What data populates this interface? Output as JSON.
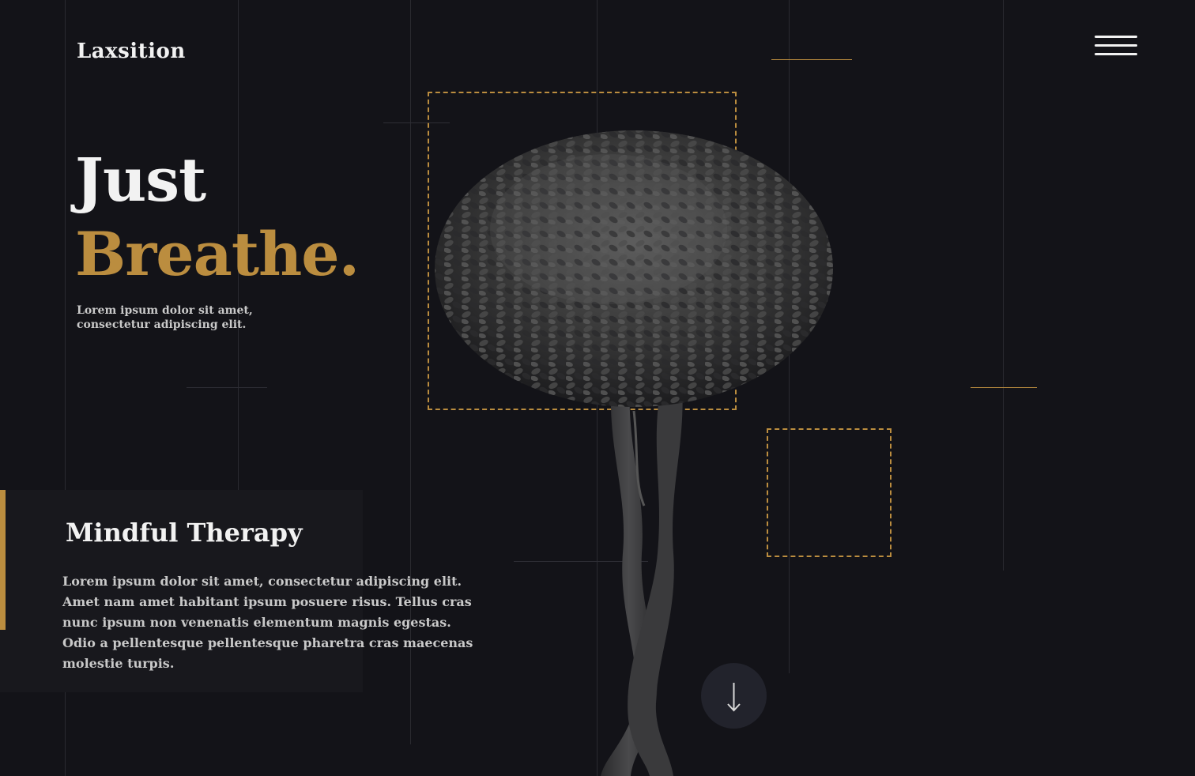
{
  "brand": {
    "name": "Laxsition"
  },
  "nav": {
    "menu_icon": "hamburger-menu-icon"
  },
  "hero": {
    "line1": "Just",
    "line2": "Breathe.",
    "subtitle": "Lorem ipsum dolor sit amet, consectetur adipiscing elit."
  },
  "feature": {
    "title": "Mindful Therapy",
    "body": "Lorem ipsum dolor sit amet, consectetur adipiscing elit. Amet nam amet habitant ipsum posuere risus. Tellus cras nunc ipsum non venenatis elementum magnis egestas. Odio a pellentesque pellentesque pharetra cras maecenas molestie turpis."
  },
  "scroll": {
    "icon": "arrow-down-icon"
  },
  "colors": {
    "background": "#131318",
    "text": "#f2f2f2",
    "muted_text": "#c9c9c9",
    "accent": "#bb8d3f",
    "card": "#18181d",
    "guide_line": "#2a2a30",
    "button_bg": "#22232c"
  }
}
